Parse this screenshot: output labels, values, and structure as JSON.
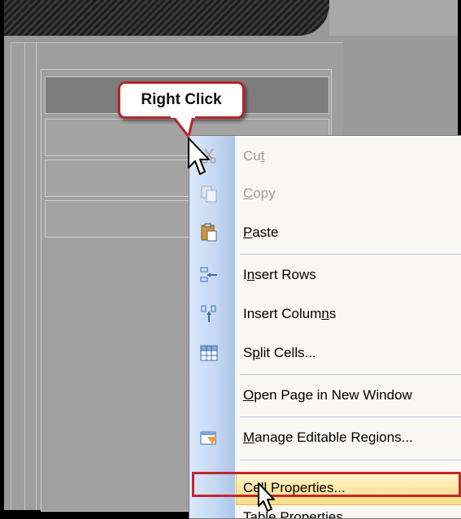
{
  "callout": {
    "text": "Right Click"
  },
  "context_menu": {
    "items": [
      {
        "before": "Cu",
        "mnemonic": "t",
        "after": "",
        "disabled": true,
        "icon": "scissors-icon"
      },
      {
        "before": "",
        "mnemonic": "C",
        "after": "opy",
        "disabled": true,
        "icon": "copy-icon"
      },
      {
        "before": "",
        "mnemonic": "P",
        "after": "aste",
        "disabled": false,
        "icon": "paste-icon"
      },
      {
        "before": "I",
        "mnemonic": "n",
        "after": "sert Rows",
        "disabled": false,
        "icon": "insert-rows-icon"
      },
      {
        "before": "Insert Colum",
        "mnemonic": "n",
        "after": "s",
        "disabled": false,
        "icon": "insert-columns-icon"
      },
      {
        "before": "S",
        "mnemonic": "p",
        "after": "lit Cells...",
        "disabled": false,
        "icon": "split-cells-icon"
      },
      {
        "before": "",
        "mnemonic": "O",
        "after": "pen Page in New Window",
        "disabled": false,
        "icon": ""
      },
      {
        "before": "",
        "mnemonic": "M",
        "after": "anage Editable Regions...",
        "disabled": false,
        "icon": "manage-regions-icon"
      },
      {
        "before": "Ce",
        "mnemonic": "l",
        "after": "l Properties...",
        "disabled": false,
        "icon": "",
        "highlighted": true
      },
      {
        "before": "Table Properties",
        "mnemonic": "",
        "after": "",
        "disabled": false,
        "icon": ""
      }
    ]
  },
  "colors": {
    "accent_red": "#c4262e",
    "highlight": "#fbdb85",
    "menu_gutter": "#c4d7f2"
  }
}
